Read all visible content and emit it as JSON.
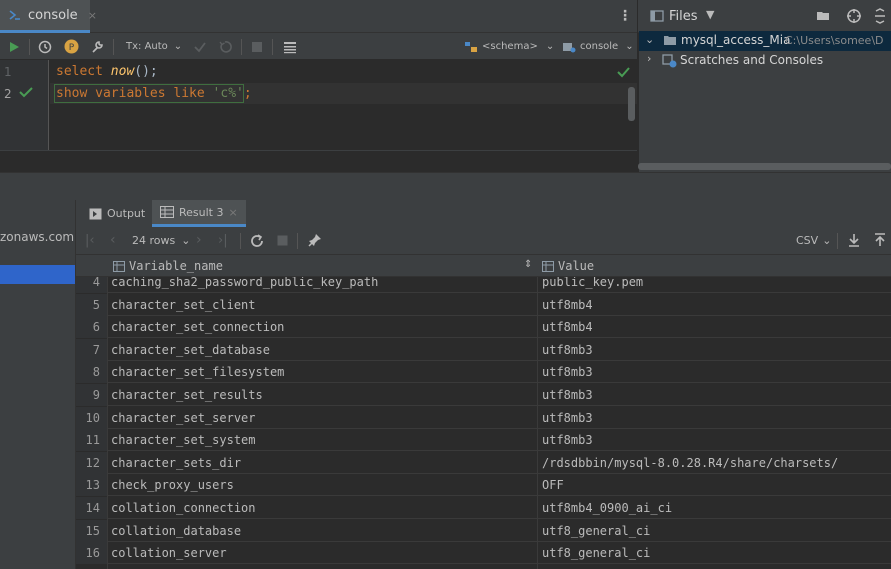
{
  "editor_tab": {
    "label": "console",
    "close": "×"
  },
  "toolbar": {
    "tx_mode": "Tx: Auto",
    "schema": "<schema>",
    "console": "console"
  },
  "editor": {
    "line_numbers": [
      "1",
      "2"
    ],
    "line1": {
      "kw": "select",
      "fn": "now",
      "rest": "();"
    },
    "line2": {
      "kw": "show variables like",
      "str": "'c%'",
      "rest": ";"
    }
  },
  "project": {
    "view_label": "Files",
    "root": {
      "name": "mysql_access_Mia",
      "path": "C:\\Users\\somee\\D"
    },
    "scratches": "Scratches and Consoles"
  },
  "services": {
    "host_suffix": "zonaws.com"
  },
  "result_tabs": [
    {
      "label": "Output"
    },
    {
      "label": "Result 3",
      "close": "×"
    }
  ],
  "result_toolbar": {
    "rows": "24 rows",
    "format": "CSV"
  },
  "grid": {
    "columns": [
      "Variable_name",
      "Value"
    ],
    "rows": [
      {
        "n": "4",
        "name": "caching_sha2_password_public_key_path",
        "value": "public_key.pem"
      },
      {
        "n": "5",
        "name": "character_set_client",
        "value": "utf8mb4"
      },
      {
        "n": "6",
        "name": "character_set_connection",
        "value": "utf8mb4"
      },
      {
        "n": "7",
        "name": "character_set_database",
        "value": "utf8mb3"
      },
      {
        "n": "8",
        "name": "character_set_filesystem",
        "value": "utf8mb3"
      },
      {
        "n": "9",
        "name": "character_set_results",
        "value": "utf8mb3"
      },
      {
        "n": "10",
        "name": "character_set_server",
        "value": "utf8mb3"
      },
      {
        "n": "11",
        "name": "character_set_system",
        "value": "utf8mb3"
      },
      {
        "n": "12",
        "name": "character_sets_dir",
        "value": "/rdsdbbin/mysql-8.0.28.R4/share/charsets/"
      },
      {
        "n": "13",
        "name": "check_proxy_users",
        "value": "OFF"
      },
      {
        "n": "14",
        "name": "collation_connection",
        "value": "utf8mb4_0900_ai_ci"
      },
      {
        "n": "15",
        "name": "collation_database",
        "value": "utf8_general_ci"
      },
      {
        "n": "16",
        "name": "collation_server",
        "value": "utf8_general_ci"
      }
    ]
  },
  "colors": {
    "accent": "#4a88c7",
    "run_green": "#499c54",
    "selection_blue": "#2f65ca"
  }
}
